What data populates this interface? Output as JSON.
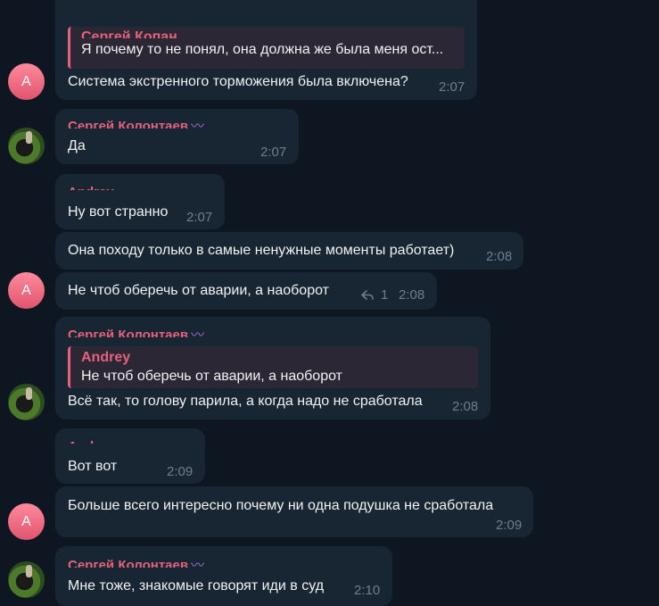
{
  "messages": [
    {
      "sender": "",
      "reply": {
        "name": "Сергей Копан",
        "text": "Я почему то не понял, она должна же была меня ост..."
      },
      "text": "Система экстренного торможения была включена?",
      "time": "2:07",
      "avatar": "A"
    },
    {
      "sender": "Сергей Колонтаев",
      "text": "Да",
      "time": "2:07",
      "avatar": "photo"
    },
    {
      "sender": "Andrey",
      "text": "Ну вот странно",
      "time": "2:07"
    },
    {
      "text": "Она походу только в самые ненужные моменты работает)",
      "time": "2:08"
    },
    {
      "text": "Не чтоб оберечь от аварии, а наоборот",
      "replies_count": "1",
      "time": "2:08",
      "avatar": "A"
    },
    {
      "sender": "Сергей Колонтаев",
      "reply": {
        "name": "Andrey",
        "text": "Не чтоб оберечь от аварии, а наоборот"
      },
      "text": "Всё так, то голову  парила, а когда надо не сработала",
      "time": "2:08",
      "avatar": "photo"
    },
    {
      "sender": "Andrey",
      "text": "Вот вот",
      "time": "2:09"
    },
    {
      "text": "Больше всего интересно почему ни одна подушка не сработала",
      "time": "2:09",
      "avatar": "A"
    },
    {
      "sender": "Сергей Колонтаев",
      "text": "Мне тоже, знакомые говорят иди  в суд",
      "time": "2:10",
      "avatar": "photo"
    }
  ],
  "colors": {
    "background": "#0e1621",
    "bubble": "#182533",
    "accent": "#e6617b",
    "time": "#6d7f8f"
  }
}
